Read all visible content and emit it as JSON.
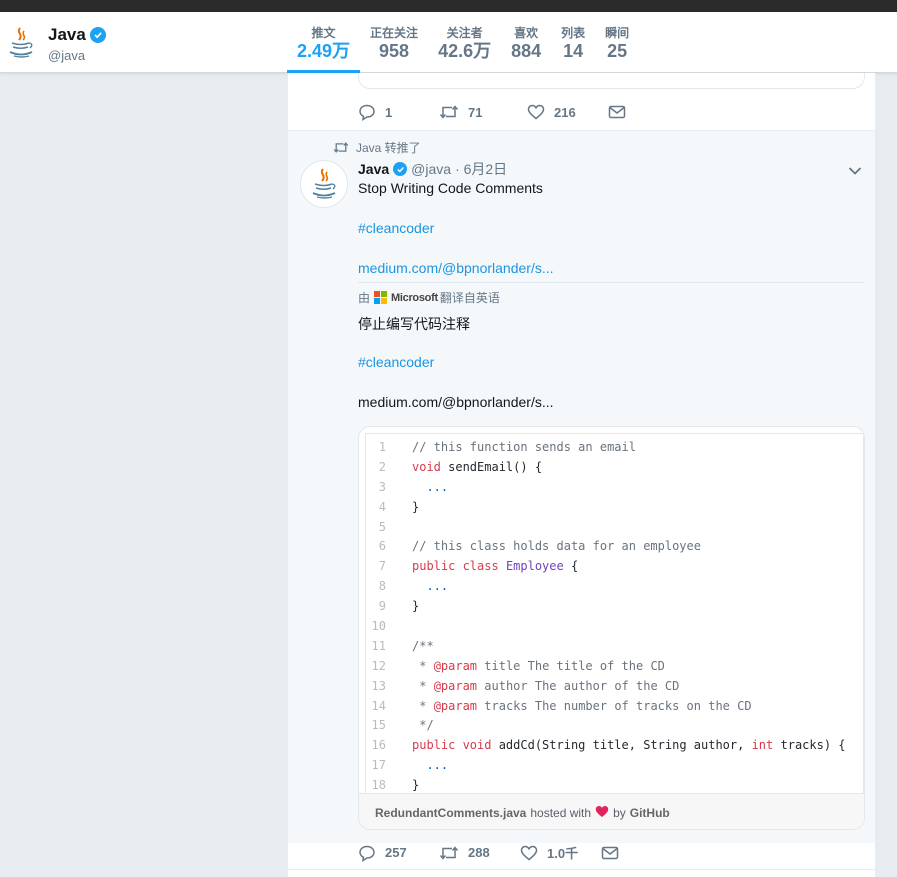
{
  "profile": {
    "name": "Java",
    "handle": "@java"
  },
  "nav": [
    {
      "label": "推文",
      "value": "2.49万",
      "active": true
    },
    {
      "label": "正在关注",
      "value": "958"
    },
    {
      "label": "关注者",
      "value": "42.6万"
    },
    {
      "label": "喜欢",
      "value": "884"
    },
    {
      "label": "列表",
      "value": "14"
    },
    {
      "label": "瞬间",
      "value": "25"
    }
  ],
  "prev_tweet": {
    "replies": "1",
    "retweets": "71",
    "likes": "216"
  },
  "tweet": {
    "retweeted_by": "Java 转推了",
    "author": "Java",
    "handle": "@java",
    "date": "· 6月2日",
    "text": "Stop Writing Code Comments",
    "hashtag": "#cleancoder",
    "link": "medium.com/@bpnorlander/s...",
    "translated_prefix": "由",
    "translator": "Microsoft",
    "translated_suffix": "翻译自英语",
    "translated_text": "停止编写代码注释",
    "translated_hashtag": "#cleancoder",
    "translated_link": "medium.com/@bpnorlander/s...",
    "gist": {
      "lines": [
        "1",
        "2",
        "3",
        "4",
        "5",
        "6",
        "7",
        "8",
        "9",
        "10",
        "11",
        "12",
        "13",
        "14",
        "15",
        "16",
        "17",
        "18"
      ],
      "filename": "RedundantComments.java",
      "hosted_with": "hosted with",
      "by": "by",
      "github": "GitHub"
    },
    "replies": "257",
    "retweets": "288",
    "likes": "1.0千"
  },
  "colors": {
    "accent": "#1da1f2",
    "link": "#1b95e0",
    "heart": "#e0245e"
  }
}
